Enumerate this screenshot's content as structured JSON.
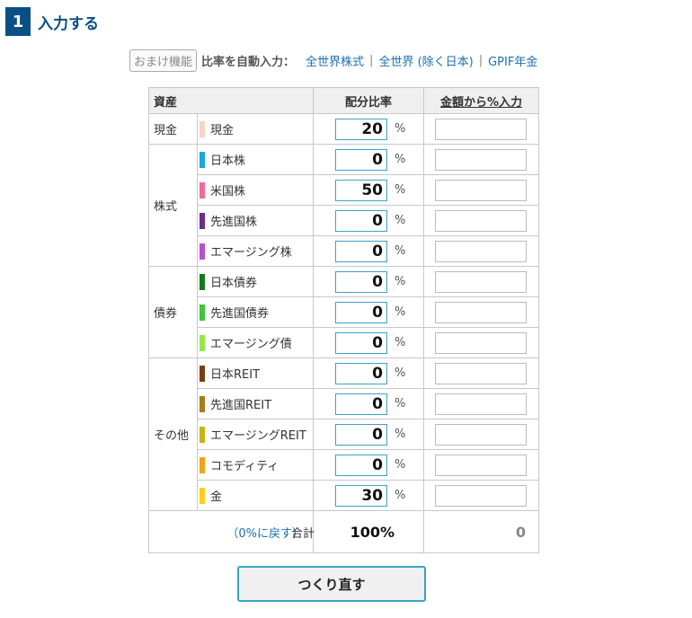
{
  "header": {
    "step_number": "1",
    "title": "入力する"
  },
  "extras": {
    "omake_label": "おまけ機能",
    "auto_label": "比率を自動入力：",
    "links": [
      "全世界株式",
      "全世界 (除く日本)",
      "GPIF年金"
    ],
    "separator": "|"
  },
  "table": {
    "col_asset": "資産",
    "col_ratio": "配分比率",
    "col_amount": "金額から%入力",
    "pct_unit": "%",
    "groups": [
      {
        "name": "現金",
        "rows": [
          {
            "label": "現金",
            "color": "#f9d3c4",
            "ratio": "20",
            "amount": ""
          }
        ]
      },
      {
        "name": "株式",
        "rows": [
          {
            "label": "日本株",
            "color": "#1aa7e0",
            "ratio": "0",
            "amount": ""
          },
          {
            "label": "米国株",
            "color": "#f26a9c",
            "ratio": "50",
            "amount": ""
          },
          {
            "label": "先進国株",
            "color": "#6c2d8f",
            "ratio": "0",
            "amount": ""
          },
          {
            "label": "エマージング株",
            "color": "#b74fcf",
            "ratio": "0",
            "amount": ""
          }
        ]
      },
      {
        "name": "債券",
        "rows": [
          {
            "label": "日本債券",
            "color": "#137a1c",
            "ratio": "0",
            "amount": ""
          },
          {
            "label": "先進国債券",
            "color": "#3fc53f",
            "ratio": "0",
            "amount": ""
          },
          {
            "label": "エマージング債",
            "color": "#93e84a",
            "ratio": "0",
            "amount": ""
          }
        ]
      },
      {
        "name": "その他",
        "rows": [
          {
            "label": "日本REIT",
            "color": "#7a3e12",
            "ratio": "0",
            "amount": ""
          },
          {
            "label": "先進国REIT",
            "color": "#a87b1e",
            "ratio": "0",
            "amount": ""
          },
          {
            "label": "エマージングREIT",
            "color": "#c5b512",
            "ratio": "0",
            "amount": ""
          },
          {
            "label": "コモディティ",
            "color": "#f5a30d",
            "ratio": "0",
            "amount": ""
          },
          {
            "label": "金",
            "color": "#f9cf16",
            "ratio": "30",
            "amount": ""
          }
        ]
      }
    ],
    "reset_label": "（0%に戻す）",
    "total_label": "合計",
    "total_value": "100%",
    "amount_total": "0"
  },
  "rebuild_button": "つくり直す"
}
